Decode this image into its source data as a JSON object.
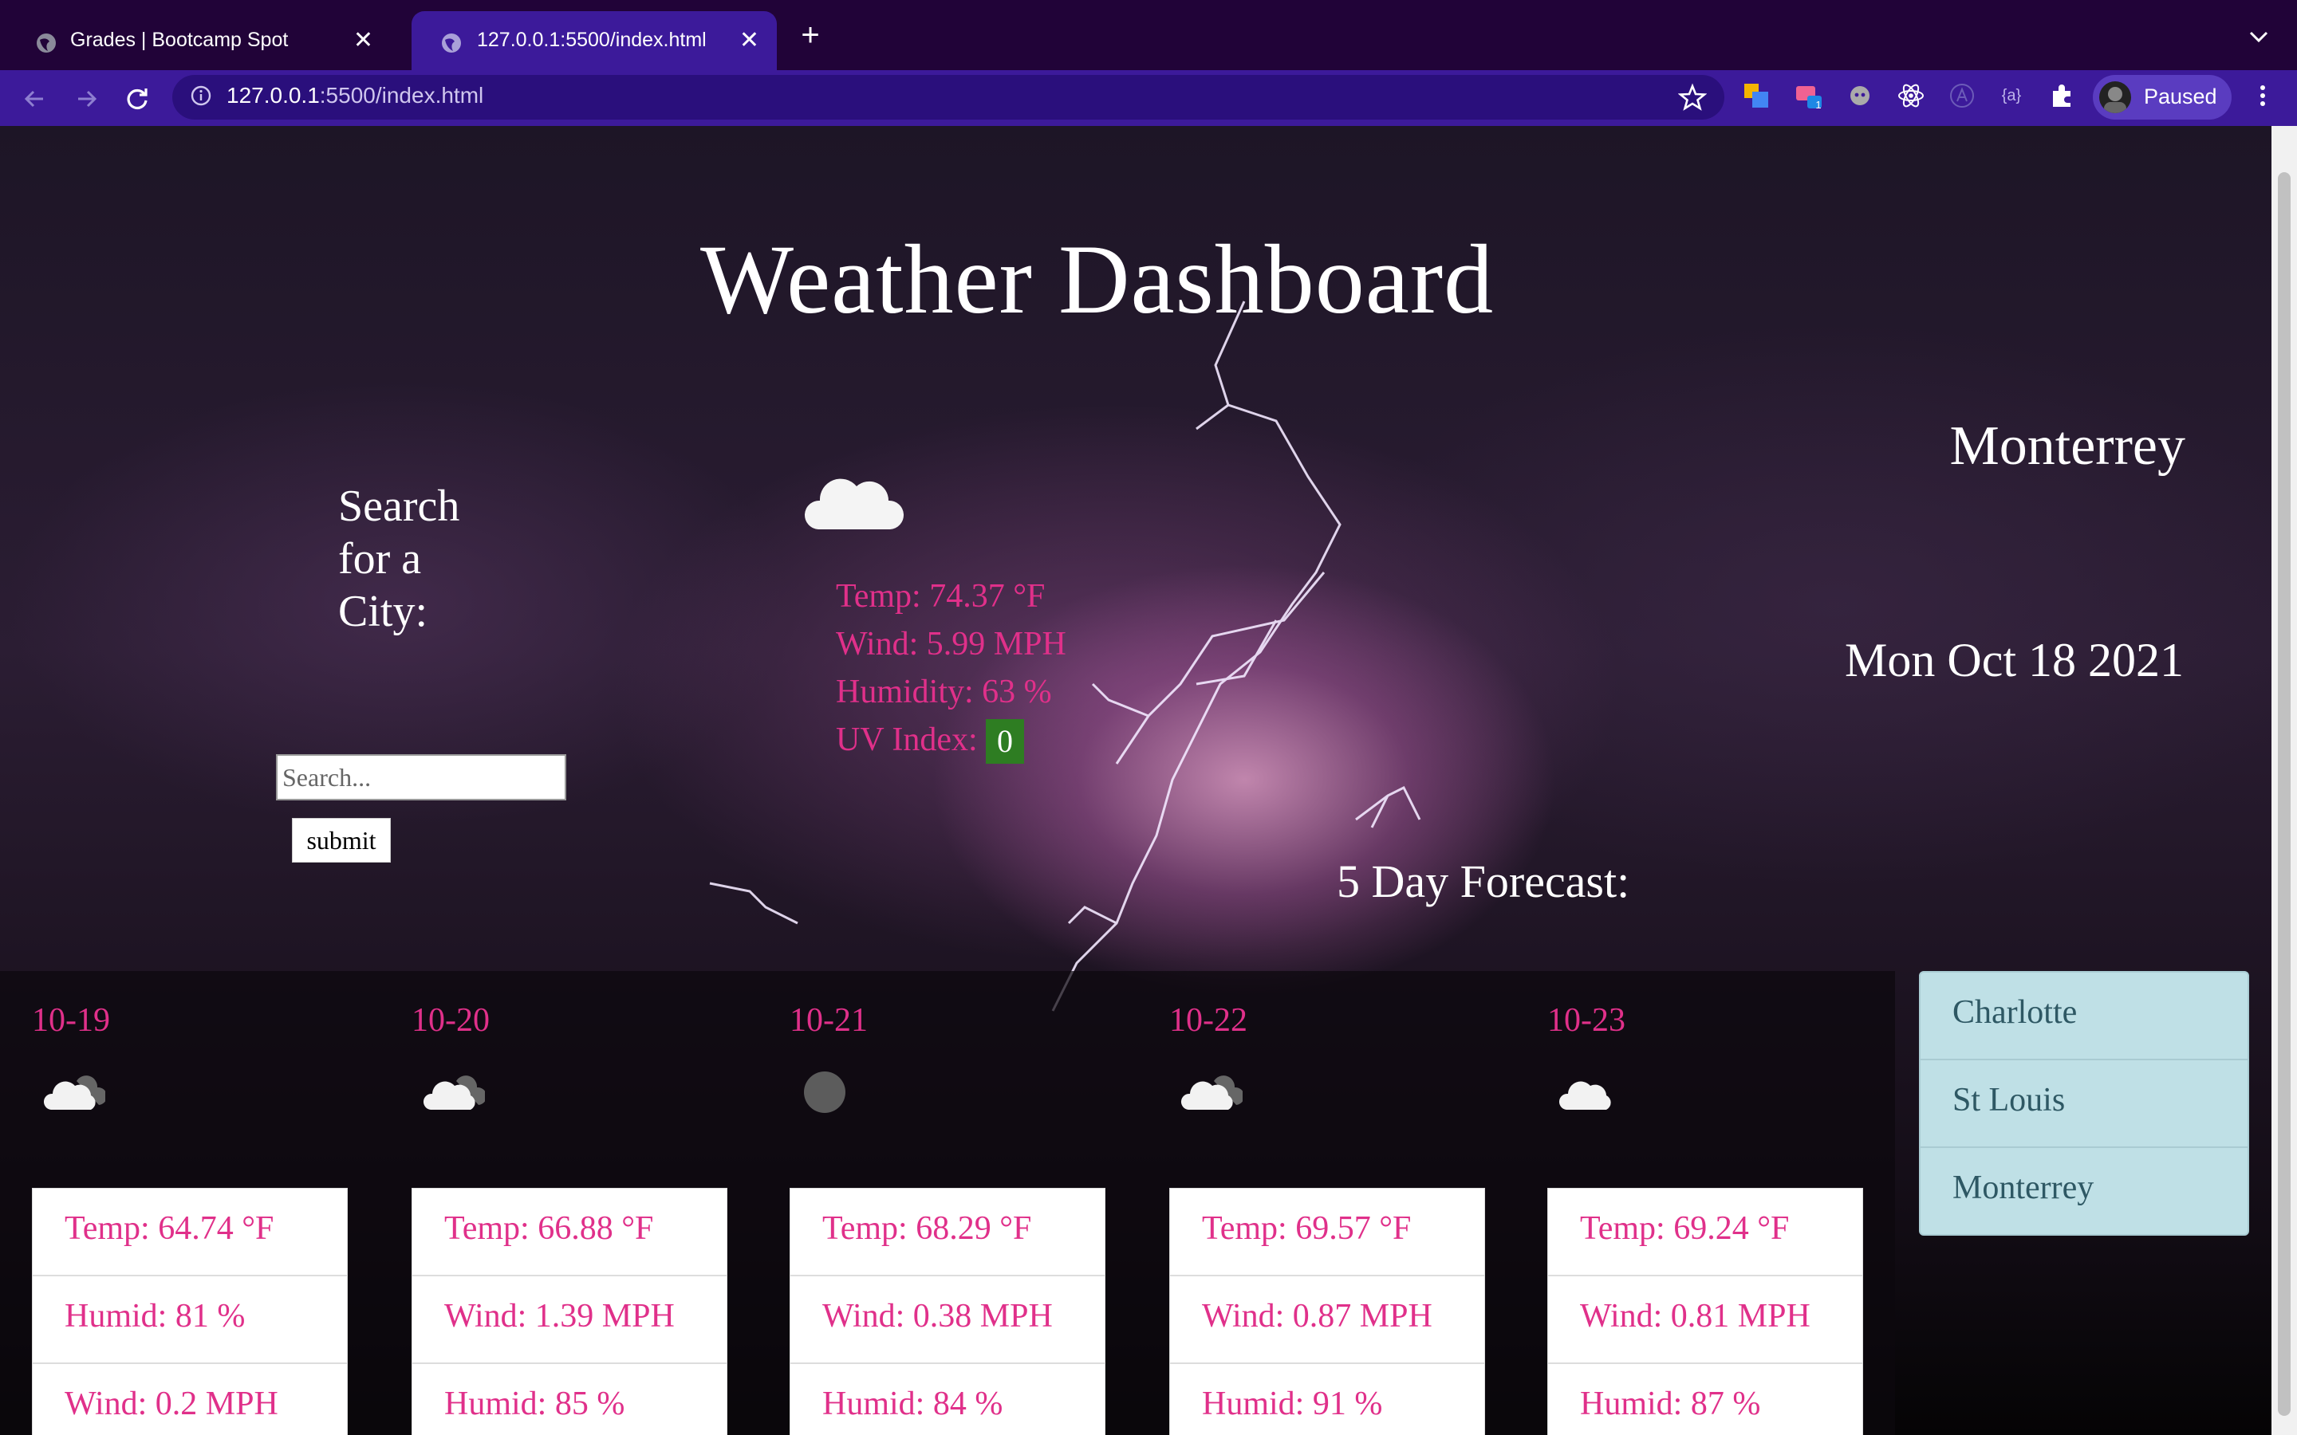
{
  "browser": {
    "tabs": [
      {
        "title": "Grades | Bootcamp Spot"
      },
      {
        "title": "127.0.0.1:5500/index.html"
      }
    ],
    "url_host": "127.0.0.1",
    "url_rest": ":5500/index.html",
    "profile_label": "Paused",
    "extension_badge": "1",
    "ext_variable_text": "{a}"
  },
  "page": {
    "title": "Weather Dashboard",
    "search_label": "Search for a City:",
    "search_placeholder": "Search...",
    "submit_label": "submit",
    "city": "Monterrey",
    "date": "Mon Oct 18 2021",
    "forecast_title": "5 Day Forecast:",
    "current": {
      "icon": "cloud-icon",
      "temp": "Temp: 74.37 °F",
      "wind": "Wind: 5.99 MPH",
      "humidity": "Humidity: 63 %",
      "uv_label": "UV Index:",
      "uv_value": "0"
    },
    "forecast": [
      {
        "date": "10-19",
        "icon": "cloud-icon",
        "lines": [
          "Temp: 64.74 °F",
          "Humid: 81 %",
          "Wind: 0.2 MPH"
        ]
      },
      {
        "date": "10-20",
        "icon": "cloud-icon",
        "lines": [
          "Temp: 66.88 °F",
          "Wind: 1.39 MPH",
          "Humid: 85 %"
        ]
      },
      {
        "date": "10-21",
        "icon": "overcast-icon",
        "lines": [
          "Temp: 68.29 °F",
          "Wind: 0.38 MPH",
          "Humid: 84 %"
        ]
      },
      {
        "date": "10-22",
        "icon": "cloud-icon",
        "lines": [
          "Temp: 69.57 °F",
          "Wind: 0.87 MPH",
          "Humid: 91 %"
        ]
      },
      {
        "date": "10-23",
        "icon": "cloud-icon",
        "lines": [
          "Temp: 69.24 °F",
          "Wind: 0.81 MPH",
          "Humid: 87 %"
        ]
      }
    ],
    "history": [
      "Charlotte",
      "St Louis",
      "Monterrey"
    ]
  },
  "colors": {
    "accent_pink": "#e0308a",
    "uv_green": "#2e7d22",
    "history_bg": "#bfe0e6",
    "browser_frame": "#3c1a9a"
  }
}
